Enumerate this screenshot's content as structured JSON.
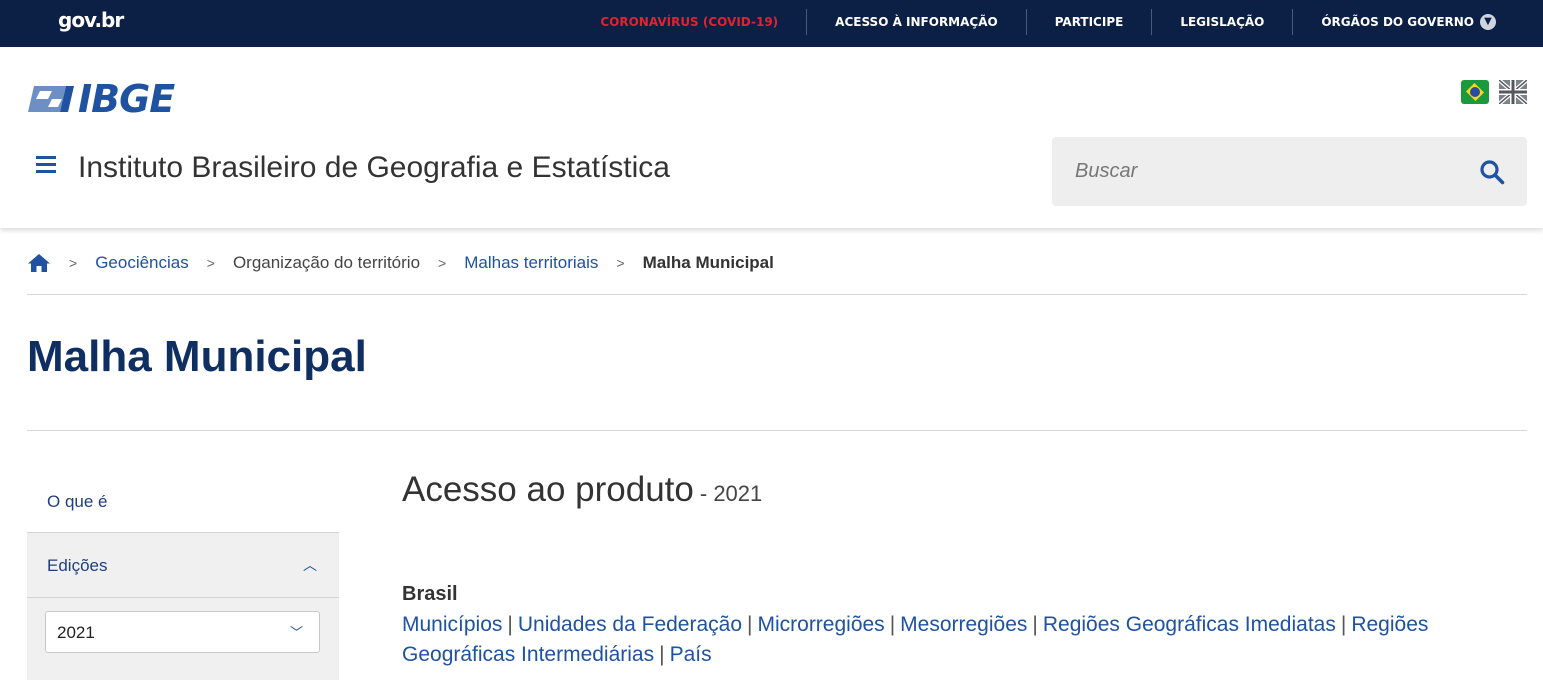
{
  "govbar": {
    "logo": "gov.br",
    "nav": [
      {
        "label": "CORONAVÍRUS (COVID-19)",
        "highlight": true
      },
      {
        "label": "ACESSO À INFORMAÇÃO"
      },
      {
        "label": "PARTICIPE"
      },
      {
        "label": "LEGISLAÇÃO"
      },
      {
        "label": "ÓRGÃOS DO GOVERNO",
        "dropdown": true
      }
    ],
    "bg_color": "#0c1f45",
    "covid_color": "#e0232f"
  },
  "header": {
    "logo_text": "IBGE",
    "site_title": "Instituto Brasileiro de Geografia e Estatística",
    "search_placeholder": "Buscar",
    "flags": [
      "brazil-flag-icon",
      "uk-flag-icon"
    ],
    "accent_color": "#1f52a0"
  },
  "breadcrumb": {
    "items": [
      {
        "label": "Geociências",
        "link": true
      },
      {
        "label": "Organização do território",
        "link": false
      },
      {
        "label": "Malhas territoriais",
        "link": true
      },
      {
        "label": "Malha Municipal",
        "current": true
      }
    ],
    "separator": ">"
  },
  "page": {
    "title": "Malha Municipal"
  },
  "sidebar": {
    "items": [
      {
        "label": "O que é"
      }
    ],
    "editions_label": "Edições",
    "edition_selected": "2021"
  },
  "main": {
    "heading": "Acesso ao produto",
    "heading_year": "- 2021",
    "region_title": "Brasil",
    "links": [
      "Municípios",
      "Unidades da Federação",
      "Microrregiões",
      "Mesorregiões",
      "Regiões Geográficas Imediatas",
      "Regiões Geográficas Intermediárias",
      "País"
    ],
    "link_separator": "|"
  }
}
